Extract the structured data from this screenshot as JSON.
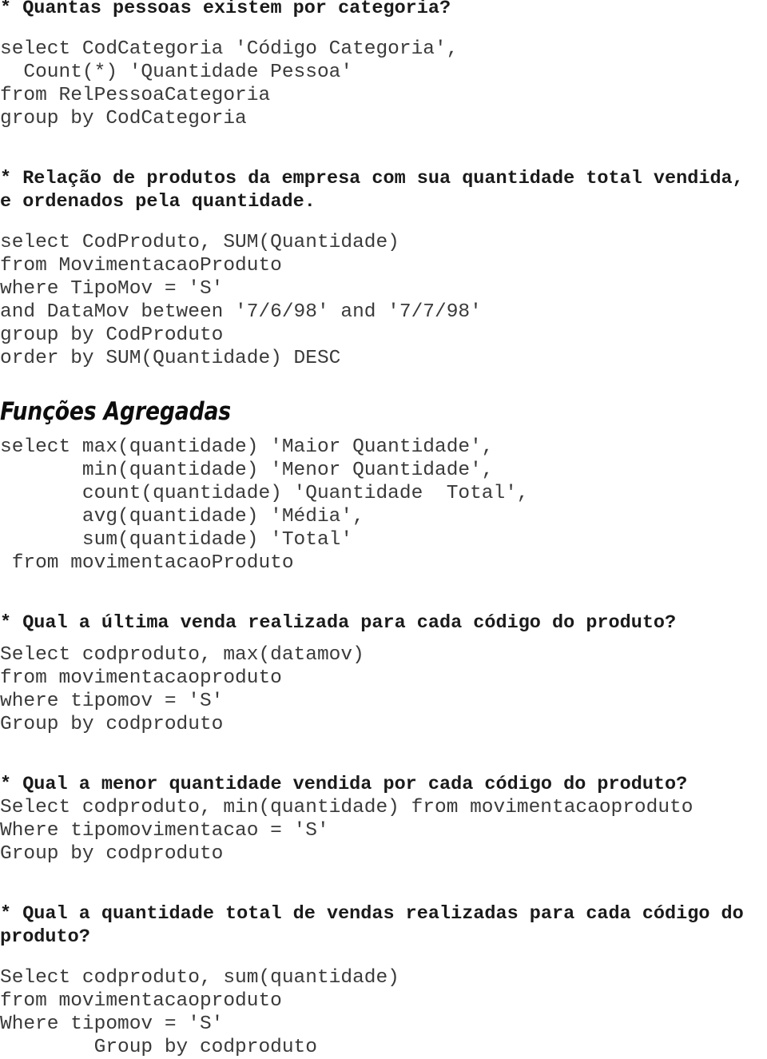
{
  "document": {
    "title": "Funções Agregadas - Notas SQL",
    "background_color": "#ffffff",
    "text_color": "#3a3a3a",
    "heading_color": "#0d0d0d"
  },
  "sections": [
    {
      "id": "quantas-pessoas",
      "question": "* Quantas pessoas existem por categoria?",
      "code": [
        "select CodCategoria 'Código Categoria',",
        "  Count(*) 'Quantidade Pessoa'",
        "from RelPessoaCategoria",
        "group by CodCategoria"
      ]
    },
    {
      "id": "relacao-produtos",
      "question_lines": [
        "* Relação de produtos da empresa com sua quantidade total vendida,",
        "e ordenados pela quantidade."
      ],
      "code": [
        "select CodProduto, SUM(Quantidade)",
        "from MovimentacaoProduto",
        "where TipoMov = 'S'",
        "and DataMov between '7/6/98' and '7/7/98'",
        "group by CodProduto",
        "order by SUM(Quantidade) DESC"
      ]
    },
    {
      "id": "funcoes-agregadas",
      "heading": "Funções Agregadas",
      "code": [
        "select max(quantidade) 'Maior Quantidade',",
        "       min(quantidade) 'Menor Quantidade',",
        "       count(quantidade) 'Quantidade  Total',",
        "       avg(quantidade) 'Média',",
        "       sum(quantidade) 'Total'",
        " from movimentacaoProduto"
      ]
    },
    {
      "id": "ultima-venda",
      "question": "* Qual a última venda realizada para cada código do produto?",
      "code": [
        "Select codproduto, max(datamov)",
        "from movimentacaoproduto",
        "where tipomov = 'S'",
        "Group by codproduto"
      ]
    },
    {
      "id": "menor-quantidade",
      "question": "* Qual a menor quantidade vendida por cada código do produto?",
      "code": [
        "Select codproduto, min(quantidade) from movimentacaoproduto",
        "Where tipomovimentacao = 'S'",
        "Group by codproduto"
      ]
    },
    {
      "id": "quantidade-total",
      "question_lines": [
        "* Qual a quantidade total de vendas realizadas para cada código do",
        "produto?"
      ],
      "code": [
        "Select codproduto, sum(quantidade)",
        "from movimentacaoproduto",
        "Where tipomov = 'S'",
        "        Group by codproduto"
      ]
    }
  ]
}
